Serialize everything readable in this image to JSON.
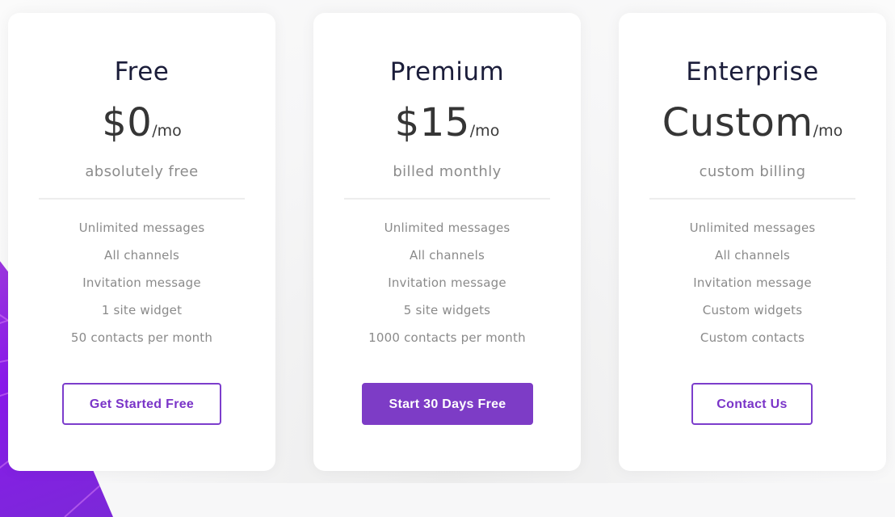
{
  "colors": {
    "accent": "#7d3cc6",
    "accent_text": "#7a34c8",
    "title_text": "#1b1d3a",
    "price_text": "#353535",
    "muted_text": "#8a8a8a",
    "decoration_purple": "#8a19ec"
  },
  "plans": [
    {
      "name": "Free",
      "price": "$0",
      "period": "/mo",
      "billing": "absolutely free",
      "features": [
        "Unlimited messages",
        "All channels",
        "Invitation message",
        "1 site widget",
        "50 contacts per month"
      ],
      "cta_label": "Get Started Free",
      "cta_style": "outline"
    },
    {
      "name": "Premium",
      "price": "$15",
      "period": "/mo",
      "billing": "billed monthly",
      "features": [
        "Unlimited messages",
        "All channels",
        "Invitation message",
        "5 site widgets",
        "1000 contacts per month"
      ],
      "cta_label": "Start 30 Days Free",
      "cta_style": "solid"
    },
    {
      "name": "Enterprise",
      "price": "Custom",
      "period": "/mo",
      "billing": "custom billing",
      "features": [
        "Unlimited messages",
        "All channels",
        "Invitation message",
        "Custom widgets",
        "Custom contacts"
      ],
      "cta_label": "Contact Us",
      "cta_style": "outline"
    }
  ]
}
